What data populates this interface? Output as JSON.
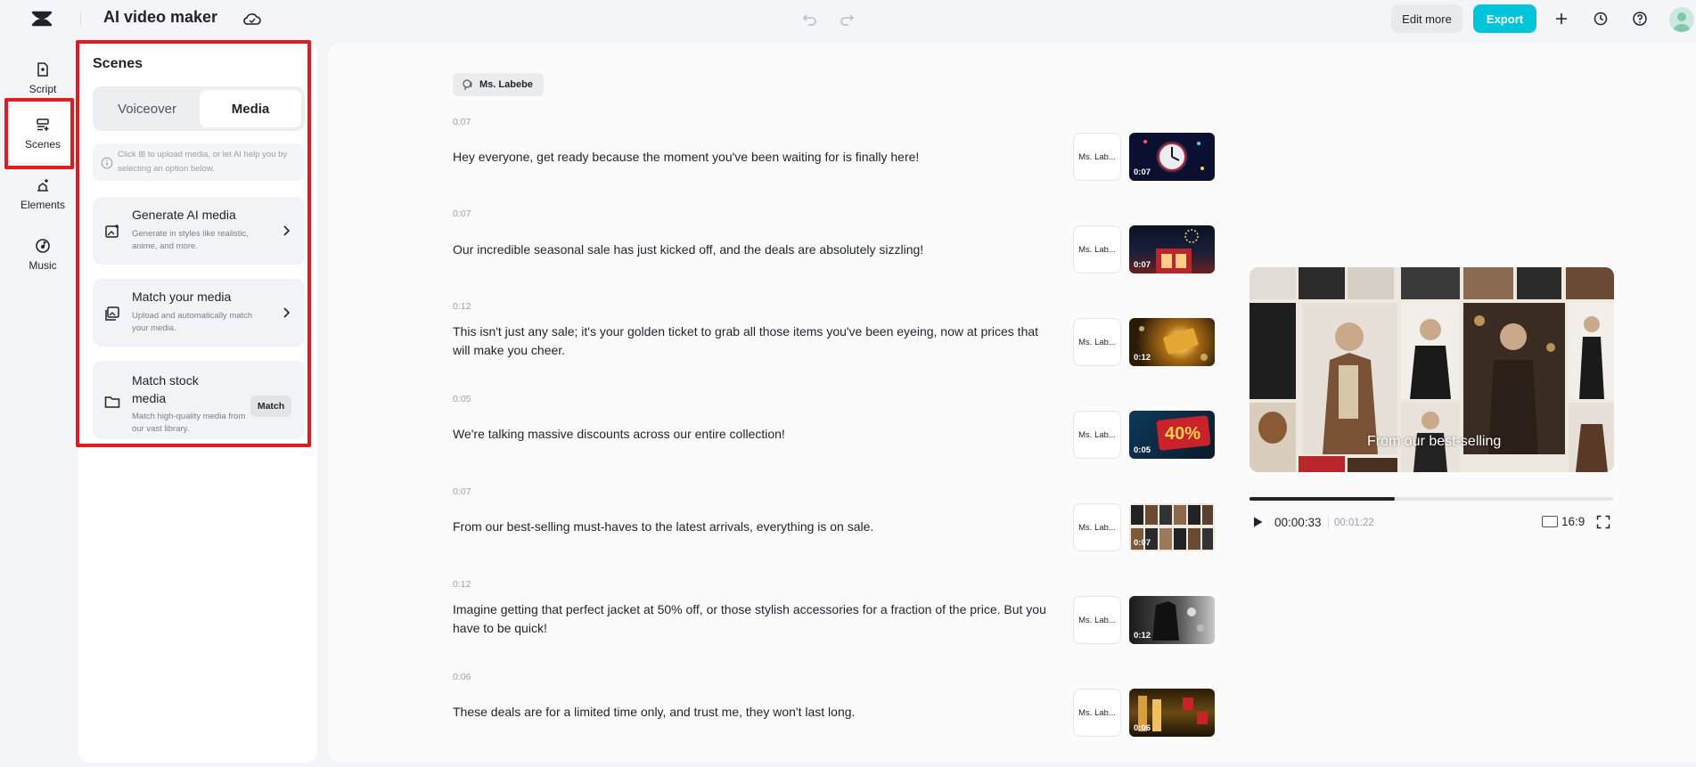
{
  "app": {
    "title": "AI video maker"
  },
  "toolbar": {
    "edit_more_label": "Edit more",
    "export_label": "Export"
  },
  "colors": {
    "accent": "#00c4d9",
    "highlight": "#e11b22"
  },
  "nav": {
    "items": [
      {
        "label": "Script",
        "icon": "script-icon"
      },
      {
        "label": "Scenes",
        "icon": "scenes-icon"
      },
      {
        "label": "Elements",
        "icon": "elements-icon"
      },
      {
        "label": "Music",
        "icon": "music-icon"
      }
    ]
  },
  "panel": {
    "title": "Scenes",
    "tabs": [
      {
        "label": "Voiceover"
      },
      {
        "label": "Media",
        "active": true
      }
    ],
    "info_text": "Click ⊞ to upload media, or let AI help you by selecting an option below.",
    "cards": [
      {
        "title": "Generate AI media",
        "desc": "Generate in styles like realistic, anime, and more.",
        "icon": "ai-media-icon"
      },
      {
        "title": "Match your media",
        "desc": "Upload and automatically match your media.",
        "icon": "match-media-icon"
      },
      {
        "title": "Match stock media",
        "desc": "Match high-quality media from our vast library.",
        "icon": "folder-icon",
        "button_label": "Match"
      }
    ]
  },
  "main": {
    "voice_name": "Ms. Labebe",
    "scenes": [
      {
        "time": "0:07",
        "text": "Hey everyone, get ready because the moment you've been waiting for is finally here!",
        "voice": "Ms. Lab...",
        "duration": "0:07"
      },
      {
        "time": "0:07",
        "text": "Our incredible seasonal sale has just kicked off, and the deals are absolutely sizzling!",
        "voice": "Ms. Lab...",
        "duration": "0:07"
      },
      {
        "time": "0:12",
        "text": "This isn't just any sale; it's your golden ticket to grab all those items you've been eyeing, now at prices that will make you cheer.",
        "voice": "Ms. Lab...",
        "duration": "0:12"
      },
      {
        "time": "0:05",
        "text": "We're talking massive discounts across our entire collection!",
        "voice": "Ms. Lab...",
        "duration": "0:05",
        "thumb_text": "40%"
      },
      {
        "time": "0:07",
        "text": "From our best-selling must-haves to the latest arrivals, everything is on sale.",
        "voice": "Ms. Lab...",
        "duration": "0:07"
      },
      {
        "time": "0:12",
        "text": "Imagine getting that perfect jacket at 50% off, or those stylish accessories for a fraction of the price. But you have to be quick!",
        "voice": "Ms. Lab...",
        "duration": "0:12"
      },
      {
        "time": "0:06",
        "text": "These deals are for a limited time only, and trust me, they won't last long.",
        "voice": "Ms. Lab...",
        "duration": "0:06"
      }
    ]
  },
  "preview": {
    "caption": "From our best-selling",
    "current_time": "00:00:33",
    "total_time": "00:01:22",
    "aspect_ratio": "16:9",
    "progress": 0.4
  }
}
